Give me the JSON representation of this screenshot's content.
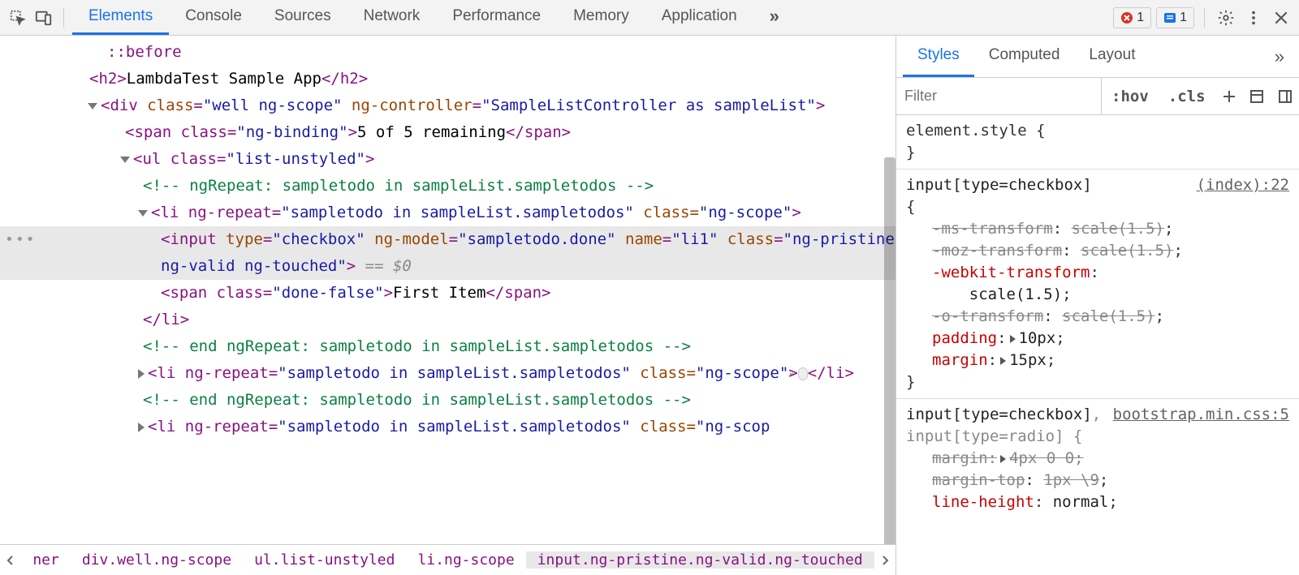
{
  "toolbar": {
    "tabs": [
      "Elements",
      "Console",
      "Sources",
      "Network",
      "Performance",
      "Memory",
      "Application"
    ],
    "active_tab": 0,
    "error_count": "1",
    "info_count": "1"
  },
  "dom": {
    "line_before": "::before",
    "h2_open": "<h2>",
    "h2_text": "LambdaTest Sample App",
    "h2_close": "</h2>",
    "div_open_pre": "<div",
    "div_class_attr": " class",
    "div_class_val": "\"well ng-scope\"",
    "div_ctrl_attr": " ng-controller",
    "div_ctrl_val": "\"SampleListController as sampleList\"",
    "div_open_end": ">",
    "span1_open": "<span class=",
    "span1_cls": "\"ng-binding\"",
    "span1_close": ">",
    "span1_text": "5 of 5 remaining",
    "span1_end": "</span>",
    "ul_open": "<ul class=",
    "ul_cls": "\"list-unstyled\"",
    "ul_end": ">",
    "comment_repeat": "<!-- ngRepeat: sampletodo in sampleList.sampletodos -->",
    "li_open": "<li ng-repeat=",
    "li_repeat_val": "\"sampletodo in sampleList.sampletodos\"",
    "li_class_attr": " class=",
    "li_class_val": "\"ng-scope\"",
    "li_end": ">",
    "input_pre": "<input",
    "input_type_attr": " type",
    "input_type_val": "\"checkbox\"",
    "input_model_attr": " ng-model",
    "input_model_val": "\"sampletodo.done\"",
    "input_name_attr": " name",
    "input_name_val": "\"li1\"",
    "input_class_attr": " class",
    "input_class_val": "\"ng-pristine ng-valid ng-touched\"",
    "input_end": ">",
    "eq_zero": " == $0",
    "span2_open": "<span class=",
    "span2_cls": "\"done-false\"",
    "span2_close": ">",
    "span2_text": "First Item",
    "span2_end": "</span>",
    "li_close": "</li>",
    "comment_end": "<!-- end ngRepeat: sampletodo in sampleList.sampletodos -->"
  },
  "breadcrumb": {
    "item0": "ner",
    "item1": "div.well.ng-scope",
    "item2": "ul.list-unstyled",
    "item3": "li.ng-scope",
    "item4": "input.ng-pristine.ng-valid.ng-touched"
  },
  "styles": {
    "tabs": [
      "Styles",
      "Computed",
      "Layout"
    ],
    "active_tab": 0,
    "filter_placeholder": "Filter",
    "hov": ":hov",
    "cls": ".cls",
    "rule0": {
      "selector": "element.style {",
      "close": "}"
    },
    "rule1": {
      "selector": "input[type=checkbox] {",
      "source": "(index):22",
      "p0_name": "-ms-transform",
      "p0_val": "scale(1.5)",
      "p1_name": "-moz-transform",
      "p1_val": "scale(1.5)",
      "p2_name": "-webkit-transform",
      "p2_val": "scale(1.5)",
      "p3_name": "-o-transform",
      "p3_val": "scale(1.5)",
      "p4_name": "padding",
      "p4_val": "10px",
      "p5_name": "margin",
      "p5_val": "15px",
      "close": "}"
    },
    "rule2": {
      "selector_a": "input[type=checkbox]",
      "selector_b": ", input[type=radio] {",
      "source": "bootstrap.min.css:5",
      "p0_name": "margin",
      "p0_val": "4px 0 0",
      "p1_name": "margin-top",
      "p1_val": "1px \\9",
      "p2_name": "line-height",
      "p2_val": "normal"
    }
  }
}
